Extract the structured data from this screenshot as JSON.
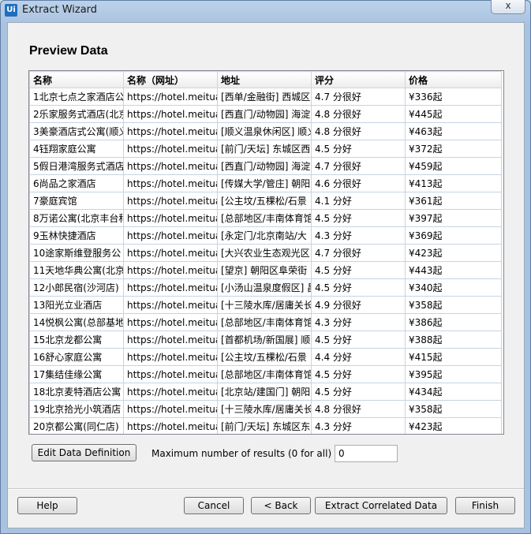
{
  "window": {
    "title": "Extract Wizard",
    "icon_text": "Ui",
    "close_glyph": "x"
  },
  "page": {
    "heading": "Preview Data"
  },
  "table": {
    "columns": [
      "名称",
      "名称（网址）",
      "地址",
      "评分",
      "价格"
    ],
    "rows": [
      [
        "1北京七点之家酒店公",
        "https://hotel.meitua",
        "[西单/金融街] 西城区",
        "4.7 分很好",
        "¥336起"
      ],
      [
        "2乐家服务式酒店(北京",
        "https://hotel.meitua",
        "[西直门/动物园] 海淀",
        "4.8 分很好",
        "¥445起"
      ],
      [
        "3美豪酒店式公寓(顺义",
        "https://hotel.meitua",
        "[顺义温泉休闲区] 顺义",
        "4.8 分很好",
        "¥463起"
      ],
      [
        "4钰翔家庭公寓",
        "https://hotel.meitua",
        "[前门/天坛] 东城区西",
        "4.5 分好",
        "¥372起"
      ],
      [
        "5假日港湾服务式酒店",
        "https://hotel.meitua",
        "[西直门/动物园] 海淀",
        "4.7 分很好",
        "¥459起"
      ],
      [
        "6尚品之家酒店",
        "https://hotel.meitua",
        "[传媒大学/管庄] 朝阳",
        "4.6 分很好",
        "¥413起"
      ],
      [
        "7豪庭宾馆",
        "https://hotel.meitua",
        "[公主坟/五棵松/石景",
        "4.1 分好",
        "¥361起"
      ],
      [
        "8万诺公寓(北京丰台科",
        "https://hotel.meitua",
        "[总部地区/丰南体育馆",
        "4.5 分好",
        "¥397起"
      ],
      [
        "9玉林快捷酒店",
        "https://hotel.meitua",
        "[永定门/北京南站/大",
        "4.3 分好",
        "¥369起"
      ],
      [
        "10途家斯维登服务公",
        "https://hotel.meitua",
        "[大兴农业生态观光区",
        "4.7 分很好",
        "¥423起"
      ],
      [
        "11天地华典公寓(北京",
        "https://hotel.meitua",
        "[望京] 朝阳区阜荣街",
        "4.5 分好",
        "¥443起"
      ],
      [
        "12小郎民宿(沙河店)",
        "https://hotel.meitua",
        "[小汤山温泉度假区] 昌",
        "4.5 分好",
        "¥340起"
      ],
      [
        "13阳光立业酒店",
        "https://hotel.meitua",
        "[十三陵水库/居庸关长",
        "4.9 分很好",
        "¥358起"
      ],
      [
        "14悦枫公寓(总部基地",
        "https://hotel.meitua",
        "[总部地区/丰南体育馆",
        "4.3 分好",
        "¥386起"
      ],
      [
        "15北京龙都公寓",
        "https://hotel.meitua",
        "[首都机场/新国展] 顺",
        "4.5 分好",
        "¥388起"
      ],
      [
        "16舒心家庭公寓",
        "https://hotel.meitua",
        "[公主坟/五棵松/石景",
        "4.4 分好",
        "¥415起"
      ],
      [
        "17集结佳缘公寓",
        "https://hotel.meitua",
        "[总部地区/丰南体育馆",
        "4.5 分好",
        "¥395起"
      ],
      [
        "18北京麦特酒店公寓",
        "https://hotel.meitua",
        "[北京站/建国门] 朝阳",
        "4.5 分好",
        "¥434起"
      ],
      [
        "19北京拾光小筑酒店",
        "https://hotel.meitua",
        "[十三陵水库/居庸关长",
        "4.8 分很好",
        "¥358起"
      ],
      [
        "20京都公寓(同仁店)",
        "https://hotel.meitua",
        "[前门/天坛] 东城区东",
        "4.3 分好",
        "¥423起"
      ]
    ]
  },
  "controls": {
    "edit_button": "Edit Data Definition",
    "max_label": "Maximum number of results (0 for all)",
    "max_value": "0"
  },
  "footer": {
    "help": "Help",
    "cancel": "Cancel",
    "back": "< Back",
    "extract_correlated": "Extract Correlated Data",
    "finish": "Finish"
  }
}
